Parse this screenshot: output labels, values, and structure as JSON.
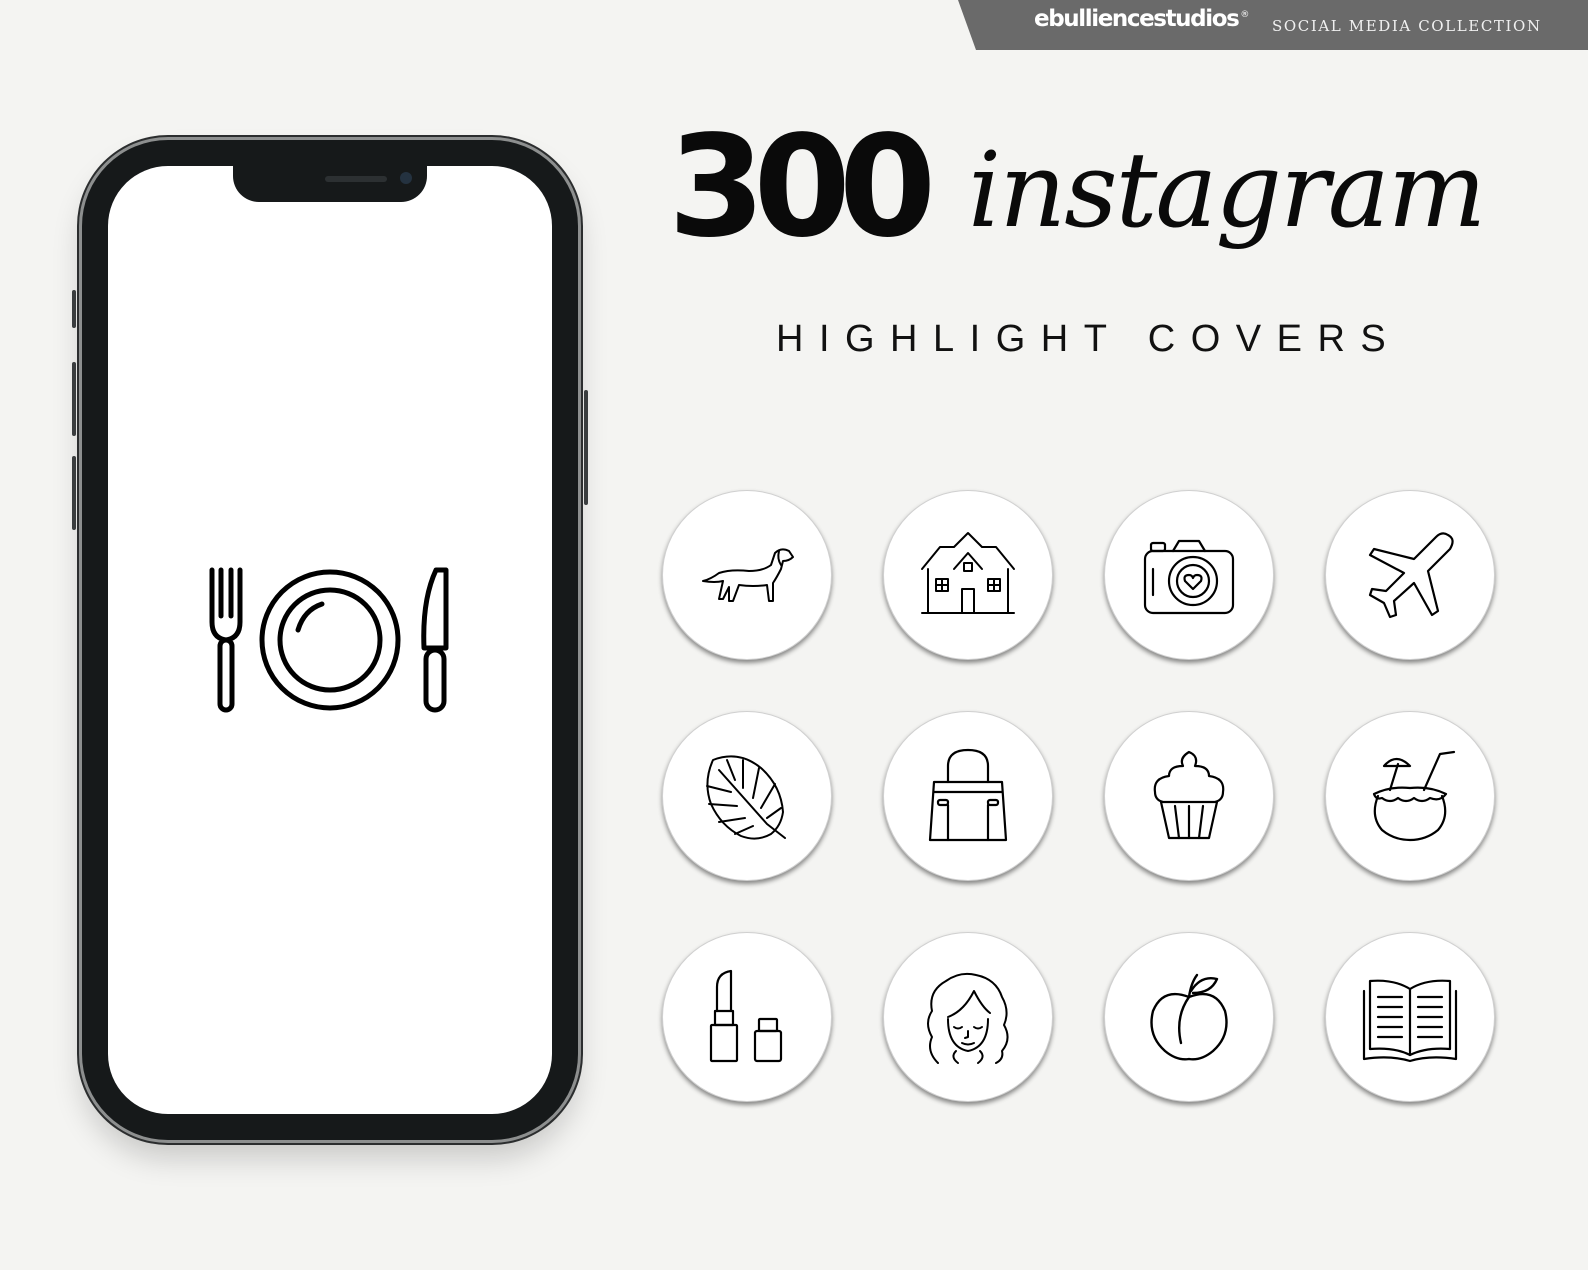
{
  "banner": {
    "brand": "ebulliencestudios",
    "registered_mark": "®",
    "collection": "SOCIAL MEDIA COLLECTION"
  },
  "headline": {
    "number": "300",
    "word": "instagram",
    "subtitle": "HIGHLIGHT COVERS"
  },
  "phone": {
    "screen_icon": "place-setting-icon"
  },
  "highlights": [
    {
      "icon": "dog-icon"
    },
    {
      "icon": "house-icon"
    },
    {
      "icon": "camera-heart-icon"
    },
    {
      "icon": "airplane-icon"
    },
    {
      "icon": "monstera-leaf-icon"
    },
    {
      "icon": "handbag-icon"
    },
    {
      "icon": "cupcake-icon"
    },
    {
      "icon": "coconut-drink-icon"
    },
    {
      "icon": "lipstick-icon"
    },
    {
      "icon": "woman-face-icon"
    },
    {
      "icon": "peach-icon"
    },
    {
      "icon": "open-book-icon"
    }
  ],
  "colors": {
    "background": "#f4f4f2",
    "banner": "#6a6a6a",
    "ink": "#0a0a0a",
    "circle": "#ffffff"
  }
}
